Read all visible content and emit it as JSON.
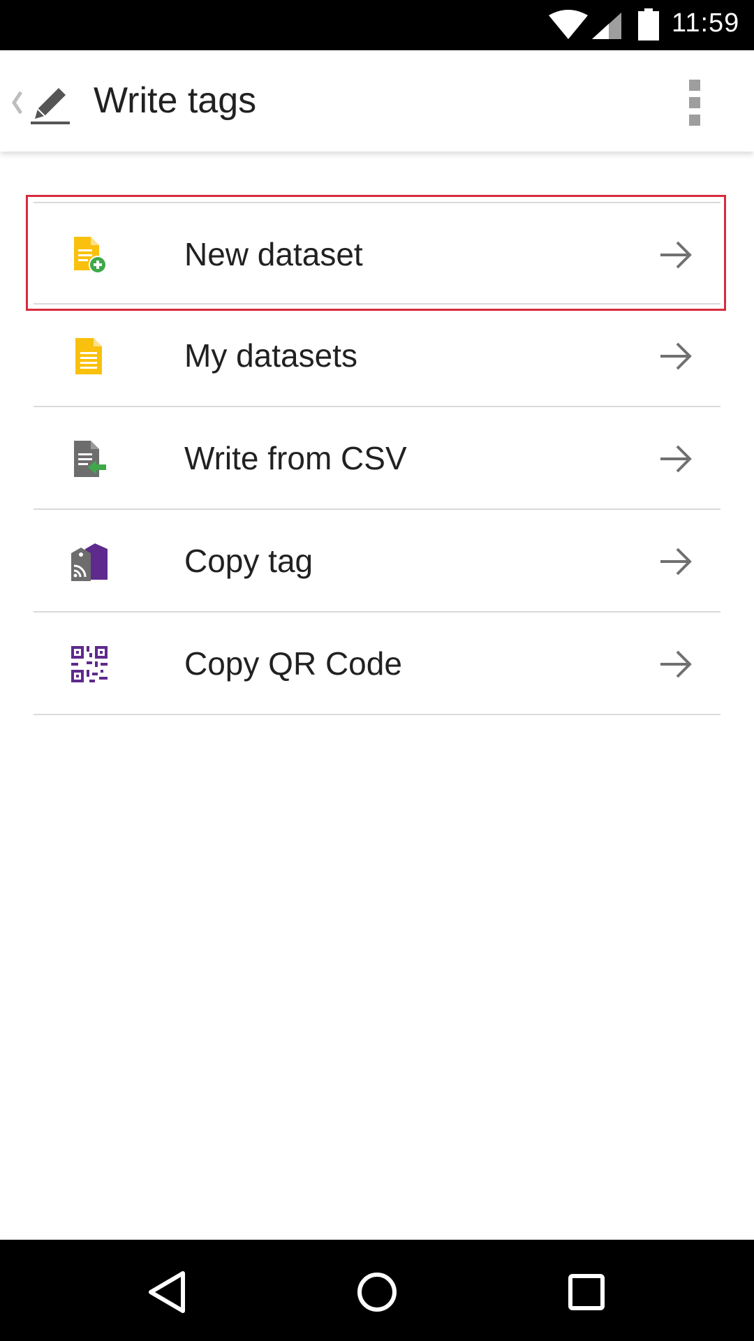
{
  "status_bar": {
    "time": "11:59",
    "icons": [
      "wifi-icon",
      "cell-signal-icon",
      "battery-icon"
    ]
  },
  "app_bar": {
    "title": "Write tags",
    "up_icon": "pencil-icon",
    "overflow_icon": "more-vert-icon"
  },
  "menu": {
    "items": [
      {
        "label": "New dataset",
        "icon": "new-dataset-icon",
        "icon_color": "#F9C10D",
        "selected": true
      },
      {
        "label": "My datasets",
        "icon": "dataset-icon",
        "icon_color": "#F9C10D"
      },
      {
        "label": "Write from CSV",
        "icon": "csv-import-icon",
        "icon_color": "#6D6D6D"
      },
      {
        "label": "Copy tag",
        "icon": "copy-tag-icon",
        "icon_color": "#5E2A8C"
      },
      {
        "label": "Copy QR Code",
        "icon": "qr-code-icon",
        "icon_color": "#5E2A8C"
      }
    ],
    "arrow_icon": "arrow-right-icon"
  },
  "highlight_color": "#D62B3D",
  "nav_bar": {
    "icons": [
      "back-icon",
      "home-icon",
      "recents-icon"
    ]
  }
}
